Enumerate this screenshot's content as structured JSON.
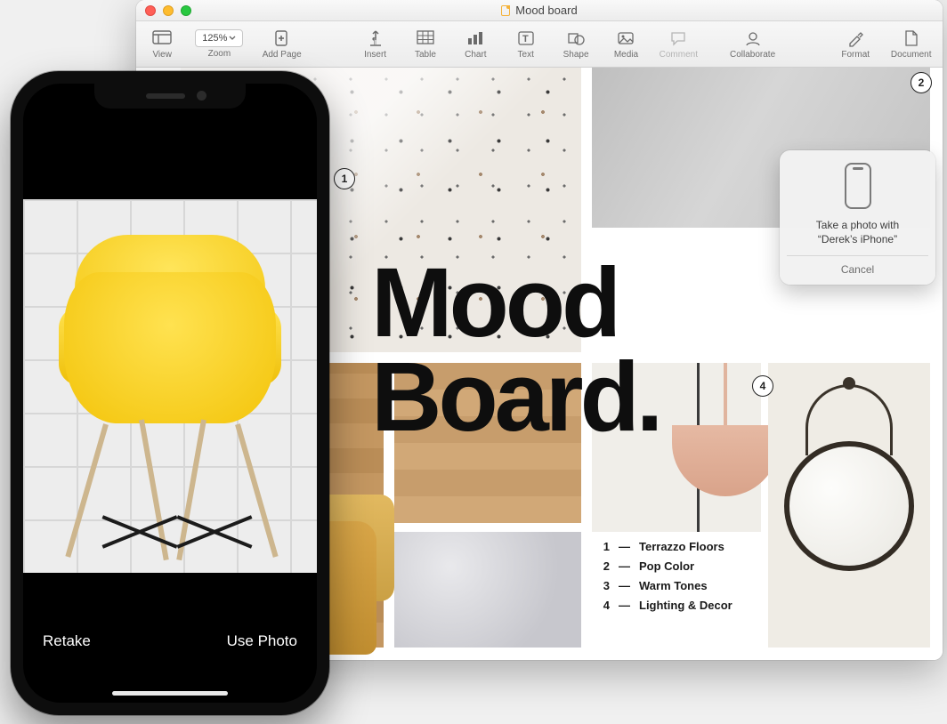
{
  "window": {
    "title": "Mood board",
    "traffic": [
      "close",
      "minimize",
      "zoom"
    ]
  },
  "toolbar": {
    "view": "View",
    "zoom_value": "125%",
    "zoom_label": "Zoom",
    "add_page": "Add Page",
    "insert": "Insert",
    "table": "Table",
    "chart": "Chart",
    "text": "Text",
    "shape": "Shape",
    "media": "Media",
    "comment": "Comment",
    "collaborate": "Collaborate",
    "format": "Format",
    "document": "Document"
  },
  "document": {
    "heading_line1": "Mood",
    "heading_line2": "Board.",
    "badges": {
      "b1": "1",
      "b2": "2",
      "b4": "4"
    },
    "list": [
      {
        "n": "1",
        "label": "Terrazzo Floors"
      },
      {
        "n": "2",
        "label": "Pop Color"
      },
      {
        "n": "3",
        "label": "Warm Tones"
      },
      {
        "n": "4",
        "label": "Lighting & Decor"
      }
    ]
  },
  "popover": {
    "line1": "Take a photo with",
    "line2": "“Derek’s iPhone”",
    "cancel": "Cancel"
  },
  "iphone": {
    "retake": "Retake",
    "use_photo": "Use Photo"
  }
}
